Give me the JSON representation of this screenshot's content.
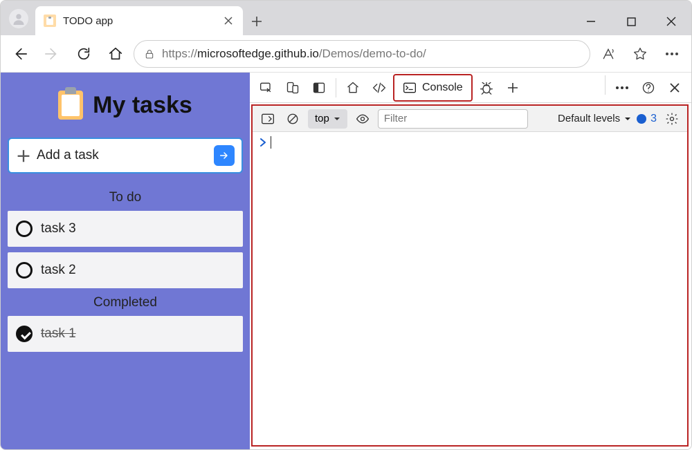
{
  "browser": {
    "tab_title": "TODO app",
    "url_proto": "https://",
    "url_host": "microsoftedge.github.io",
    "url_path": "/Demos/demo-to-do/"
  },
  "app": {
    "title": "My tasks",
    "add_task_label": "Add a task",
    "sections": {
      "todo_label": "To do",
      "completed_label": "Completed"
    },
    "todo": [
      {
        "text": "task 3"
      },
      {
        "text": "task 2"
      }
    ],
    "completed": [
      {
        "text": "task 1"
      }
    ]
  },
  "devtools": {
    "active_tab_label": "Console",
    "console": {
      "context_label": "top",
      "filter_placeholder": "Filter",
      "levels_label": "Default levels",
      "issues_count": "3",
      "prompt": ">"
    }
  }
}
